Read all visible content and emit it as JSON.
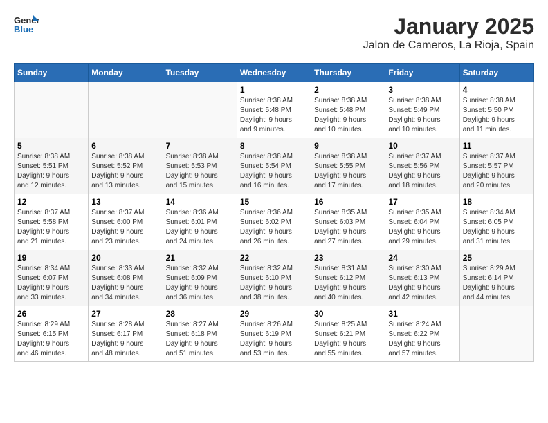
{
  "header": {
    "logo_line1": "General",
    "logo_line2": "Blue",
    "title": "January 2025",
    "subtitle": "Jalon de Cameros, La Rioja, Spain"
  },
  "weekdays": [
    "Sunday",
    "Monday",
    "Tuesday",
    "Wednesday",
    "Thursday",
    "Friday",
    "Saturday"
  ],
  "weeks": [
    [
      {
        "day": "",
        "info": ""
      },
      {
        "day": "",
        "info": ""
      },
      {
        "day": "",
        "info": ""
      },
      {
        "day": "1",
        "info": "Sunrise: 8:38 AM\nSunset: 5:48 PM\nDaylight: 9 hours\nand 9 minutes."
      },
      {
        "day": "2",
        "info": "Sunrise: 8:38 AM\nSunset: 5:48 PM\nDaylight: 9 hours\nand 10 minutes."
      },
      {
        "day": "3",
        "info": "Sunrise: 8:38 AM\nSunset: 5:49 PM\nDaylight: 9 hours\nand 10 minutes."
      },
      {
        "day": "4",
        "info": "Sunrise: 8:38 AM\nSunset: 5:50 PM\nDaylight: 9 hours\nand 11 minutes."
      }
    ],
    [
      {
        "day": "5",
        "info": "Sunrise: 8:38 AM\nSunset: 5:51 PM\nDaylight: 9 hours\nand 12 minutes."
      },
      {
        "day": "6",
        "info": "Sunrise: 8:38 AM\nSunset: 5:52 PM\nDaylight: 9 hours\nand 13 minutes."
      },
      {
        "day": "7",
        "info": "Sunrise: 8:38 AM\nSunset: 5:53 PM\nDaylight: 9 hours\nand 15 minutes."
      },
      {
        "day": "8",
        "info": "Sunrise: 8:38 AM\nSunset: 5:54 PM\nDaylight: 9 hours\nand 16 minutes."
      },
      {
        "day": "9",
        "info": "Sunrise: 8:38 AM\nSunset: 5:55 PM\nDaylight: 9 hours\nand 17 minutes."
      },
      {
        "day": "10",
        "info": "Sunrise: 8:37 AM\nSunset: 5:56 PM\nDaylight: 9 hours\nand 18 minutes."
      },
      {
        "day": "11",
        "info": "Sunrise: 8:37 AM\nSunset: 5:57 PM\nDaylight: 9 hours\nand 20 minutes."
      }
    ],
    [
      {
        "day": "12",
        "info": "Sunrise: 8:37 AM\nSunset: 5:58 PM\nDaylight: 9 hours\nand 21 minutes."
      },
      {
        "day": "13",
        "info": "Sunrise: 8:37 AM\nSunset: 6:00 PM\nDaylight: 9 hours\nand 23 minutes."
      },
      {
        "day": "14",
        "info": "Sunrise: 8:36 AM\nSunset: 6:01 PM\nDaylight: 9 hours\nand 24 minutes."
      },
      {
        "day": "15",
        "info": "Sunrise: 8:36 AM\nSunset: 6:02 PM\nDaylight: 9 hours\nand 26 minutes."
      },
      {
        "day": "16",
        "info": "Sunrise: 8:35 AM\nSunset: 6:03 PM\nDaylight: 9 hours\nand 27 minutes."
      },
      {
        "day": "17",
        "info": "Sunrise: 8:35 AM\nSunset: 6:04 PM\nDaylight: 9 hours\nand 29 minutes."
      },
      {
        "day": "18",
        "info": "Sunrise: 8:34 AM\nSunset: 6:05 PM\nDaylight: 9 hours\nand 31 minutes."
      }
    ],
    [
      {
        "day": "19",
        "info": "Sunrise: 8:34 AM\nSunset: 6:07 PM\nDaylight: 9 hours\nand 33 minutes."
      },
      {
        "day": "20",
        "info": "Sunrise: 8:33 AM\nSunset: 6:08 PM\nDaylight: 9 hours\nand 34 minutes."
      },
      {
        "day": "21",
        "info": "Sunrise: 8:32 AM\nSunset: 6:09 PM\nDaylight: 9 hours\nand 36 minutes."
      },
      {
        "day": "22",
        "info": "Sunrise: 8:32 AM\nSunset: 6:10 PM\nDaylight: 9 hours\nand 38 minutes."
      },
      {
        "day": "23",
        "info": "Sunrise: 8:31 AM\nSunset: 6:12 PM\nDaylight: 9 hours\nand 40 minutes."
      },
      {
        "day": "24",
        "info": "Sunrise: 8:30 AM\nSunset: 6:13 PM\nDaylight: 9 hours\nand 42 minutes."
      },
      {
        "day": "25",
        "info": "Sunrise: 8:29 AM\nSunset: 6:14 PM\nDaylight: 9 hours\nand 44 minutes."
      }
    ],
    [
      {
        "day": "26",
        "info": "Sunrise: 8:29 AM\nSunset: 6:15 PM\nDaylight: 9 hours\nand 46 minutes."
      },
      {
        "day": "27",
        "info": "Sunrise: 8:28 AM\nSunset: 6:17 PM\nDaylight: 9 hours\nand 48 minutes."
      },
      {
        "day": "28",
        "info": "Sunrise: 8:27 AM\nSunset: 6:18 PM\nDaylight: 9 hours\nand 51 minutes."
      },
      {
        "day": "29",
        "info": "Sunrise: 8:26 AM\nSunset: 6:19 PM\nDaylight: 9 hours\nand 53 minutes."
      },
      {
        "day": "30",
        "info": "Sunrise: 8:25 AM\nSunset: 6:21 PM\nDaylight: 9 hours\nand 55 minutes."
      },
      {
        "day": "31",
        "info": "Sunrise: 8:24 AM\nSunset: 6:22 PM\nDaylight: 9 hours\nand 57 minutes."
      },
      {
        "day": "",
        "info": ""
      }
    ]
  ]
}
